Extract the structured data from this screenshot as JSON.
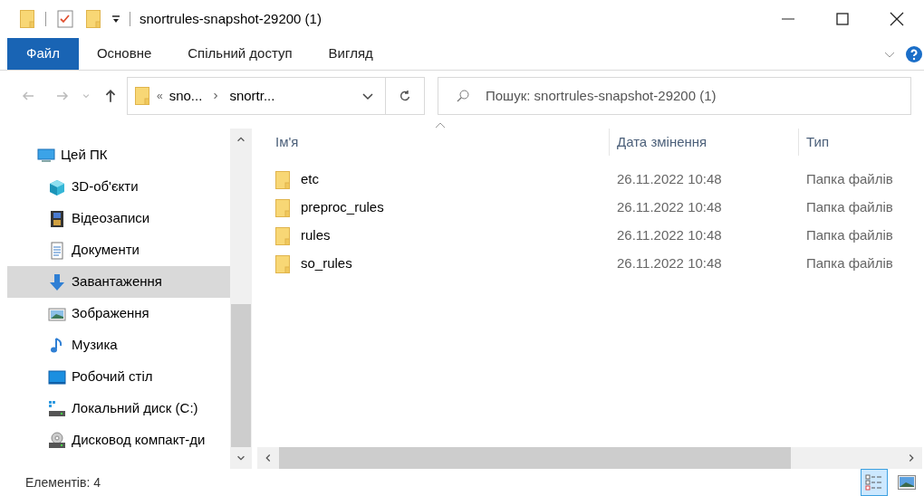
{
  "window": {
    "title": "snortrules-snapshot-29200 (1)"
  },
  "ribbon_tabs": [
    {
      "label": "Файл",
      "selected": true
    },
    {
      "label": "Основне",
      "selected": false
    },
    {
      "label": "Спільний доступ",
      "selected": false
    },
    {
      "label": "Вигляд",
      "selected": false
    }
  ],
  "address": {
    "overflow": "«",
    "path": [
      {
        "label": "sno..."
      },
      {
        "label": "snortr..."
      }
    ]
  },
  "search": {
    "placeholder": "Пошук: snortrules-snapshot-29200 (1)"
  },
  "sidebar": {
    "items": [
      {
        "label": "Цей ПК",
        "kind": "pc",
        "selected": false,
        "children": [
          {
            "label": "3D-об'єкти",
            "kind": "cube",
            "selected": false
          },
          {
            "label": "Відеозаписи",
            "kind": "video",
            "selected": false
          },
          {
            "label": "Документи",
            "kind": "document",
            "selected": false
          },
          {
            "label": "Завантаження",
            "kind": "download",
            "selected": true
          },
          {
            "label": "Зображення",
            "kind": "picture",
            "selected": false
          },
          {
            "label": "Музика",
            "kind": "music",
            "selected": false
          },
          {
            "label": "Робочий стіл",
            "kind": "desktop",
            "selected": false
          },
          {
            "label": "Локальний диск (C:)",
            "kind": "drive",
            "selected": false
          },
          {
            "label": "Дисковод компакт-ди",
            "kind": "cd",
            "selected": false
          }
        ]
      }
    ]
  },
  "table": {
    "columns": [
      "Ім'я",
      "Дата змінення",
      "Тип"
    ],
    "rows": [
      {
        "name": "etc",
        "date": "26.11.2022 10:48",
        "type": "Папка файлів"
      },
      {
        "name": "preproc_rules",
        "date": "26.11.2022 10:48",
        "type": "Папка файлів"
      },
      {
        "name": "rules",
        "date": "26.11.2022 10:48",
        "type": "Папка файлів"
      },
      {
        "name": "so_rules",
        "date": "26.11.2022 10:48",
        "type": "Папка файлів"
      }
    ]
  },
  "status_bar": {
    "count": "Елементів: 4"
  },
  "view_buttons": [
    {
      "kind": "details",
      "selected": true
    },
    {
      "kind": "tiles",
      "selected": false
    }
  ]
}
